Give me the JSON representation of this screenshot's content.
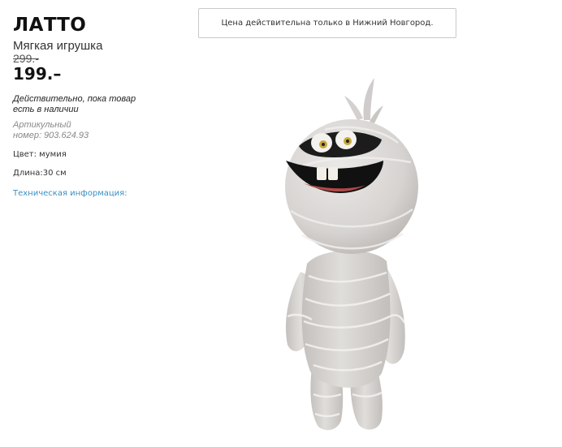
{
  "product": {
    "name": "ЛАТТО",
    "type": "Мягкая игрушка",
    "old_price": "299.-",
    "price": "199.–",
    "availability": "Действительно, пока товар есть в наличии",
    "article_line1": "Артикульный",
    "article_line2": "номер: 903.624.93",
    "color": "Цвет: мумия",
    "length": "Длина:30 см",
    "tech_info_link": "Техническая информация:",
    "image_icon": "mummy-plush-toy"
  },
  "notice": {
    "text": "Цена действительна только в Нижний Новгород."
  },
  "colors": {
    "link": "#3a8fc4",
    "plush": "#d8d6d4"
  }
}
